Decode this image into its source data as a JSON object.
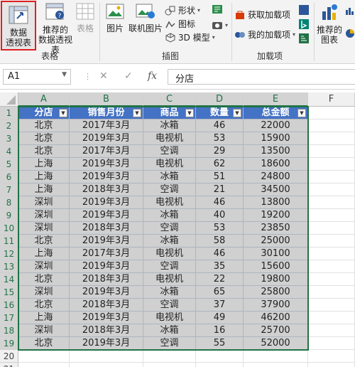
{
  "ribbon": {
    "pivot_table": "数据\n透视表",
    "recommended_pivot": "推荐的\n数据透视表",
    "table": "表格",
    "group_tables": "表格",
    "picture": "图片",
    "online_picture": "联机图片",
    "shapes": "形状",
    "icons": "图标",
    "model3d": "3D 模型",
    "group_illustrations": "插图",
    "get_addins": "获取加载项",
    "my_addins": "我的加载项",
    "group_addins": "加载项",
    "recommended_charts": "推荐的\n图表"
  },
  "formula_bar": {
    "name_box": "A1",
    "formula": "分店"
  },
  "columns": [
    "A",
    "B",
    "C",
    "D",
    "E",
    "F"
  ],
  "rows": [
    "1",
    "2",
    "3",
    "4",
    "5",
    "6",
    "7",
    "8",
    "9",
    "10",
    "11",
    "12",
    "13",
    "14",
    "15",
    "16",
    "17",
    "18",
    "19",
    "20",
    "21"
  ],
  "table": {
    "headers": [
      "分店",
      "销售月份",
      "商品",
      "数量",
      "总金额"
    ],
    "data": [
      [
        "北京",
        "2017年3月",
        "冰箱",
        "46",
        "22000"
      ],
      [
        "北京",
        "2019年3月",
        "电视机",
        "53",
        "15900"
      ],
      [
        "北京",
        "2017年3月",
        "空调",
        "29",
        "13500"
      ],
      [
        "上海",
        "2019年3月",
        "电视机",
        "62",
        "18600"
      ],
      [
        "上海",
        "2019年3月",
        "冰箱",
        "51",
        "24800"
      ],
      [
        "上海",
        "2018年3月",
        "空调",
        "21",
        "34500"
      ],
      [
        "深圳",
        "2019年3月",
        "电视机",
        "46",
        "13800"
      ],
      [
        "深圳",
        "2019年3月",
        "冰箱",
        "40",
        "19200"
      ],
      [
        "深圳",
        "2018年3月",
        "空调",
        "53",
        "23850"
      ],
      [
        "北京",
        "2019年3月",
        "冰箱",
        "58",
        "25000"
      ],
      [
        "上海",
        "2017年3月",
        "电视机",
        "46",
        "30100"
      ],
      [
        "深圳",
        "2019年3月",
        "空调",
        "35",
        "15600"
      ],
      [
        "北京",
        "2018年3月",
        "电视机",
        "22",
        "19800"
      ],
      [
        "深圳",
        "2019年3月",
        "冰箱",
        "65",
        "25800"
      ],
      [
        "北京",
        "2018年3月",
        "空调",
        "37",
        "37900"
      ],
      [
        "上海",
        "2019年3月",
        "电视机",
        "49",
        "46200"
      ],
      [
        "深圳",
        "2018年3月",
        "冰箱",
        "16",
        "25700"
      ],
      [
        "北京",
        "2019年3月",
        "空调",
        "55",
        "52000"
      ]
    ]
  },
  "colors": {
    "header_fill": "#4472c4",
    "data_fill": "#d0d0d0",
    "highlight_border": "#e02020",
    "accent": "#217346"
  }
}
